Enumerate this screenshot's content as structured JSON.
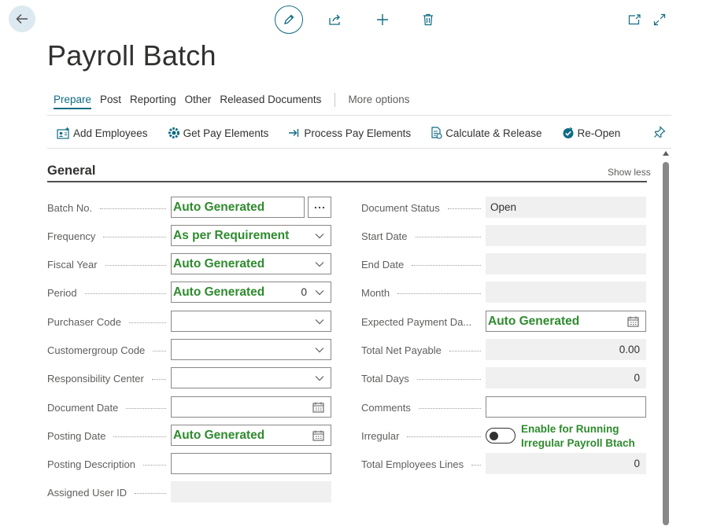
{
  "header": {
    "icons": {
      "back": "arrow-left-icon",
      "edit": "pencil-icon",
      "share": "share-icon",
      "new": "plus-icon",
      "delete": "trash-icon",
      "open_new_window": "open-in-new-window-icon",
      "expand": "expand-icon"
    }
  },
  "page": {
    "title": "Payroll Batch"
  },
  "tabs": [
    {
      "label": "Prepare",
      "active": true
    },
    {
      "label": "Post"
    },
    {
      "label": "Reporting"
    },
    {
      "label": "Other"
    },
    {
      "label": "Released Documents"
    }
  ],
  "more_options": "More options",
  "actions": [
    {
      "label": "Add Employees",
      "icon": "add-employees-icon"
    },
    {
      "label": "Get Pay Elements",
      "icon": "gear-icon"
    },
    {
      "label": "Process Pay Elements",
      "icon": "process-arrow-icon"
    },
    {
      "label": "Calculate & Release",
      "icon": "calculate-icon"
    },
    {
      "label": "Re-Open",
      "icon": "reopen-check-icon"
    }
  ],
  "section": {
    "title": "General",
    "toggle_label": "Show less"
  },
  "left_fields": {
    "batch_no": {
      "label": "Batch No.",
      "value": "Auto Generated"
    },
    "frequency": {
      "label": "Frequency",
      "value": "As per Requirement"
    },
    "fiscal_year": {
      "label": "Fiscal Year",
      "value": "Auto Generated"
    },
    "period": {
      "label": "Period",
      "value": "Auto Generated",
      "number": "0"
    },
    "purchaser_code": {
      "label": "Purchaser Code",
      "value": ""
    },
    "customergroup_code": {
      "label": "Customergroup Code",
      "value": ""
    },
    "responsibility_center": {
      "label": "Responsibility Center",
      "value": ""
    },
    "document_date": {
      "label": "Document Date",
      "value": ""
    },
    "posting_date": {
      "label": "Posting Date",
      "value": "Auto Generated"
    },
    "posting_description": {
      "label": "Posting Description",
      "value": ""
    },
    "assigned_user_id": {
      "label": "Assigned User ID",
      "value": ""
    }
  },
  "right_fields": {
    "document_status": {
      "label": "Document Status",
      "value": "Open"
    },
    "start_date": {
      "label": "Start Date",
      "value": ""
    },
    "end_date": {
      "label": "End Date",
      "value": ""
    },
    "month": {
      "label": "Month",
      "value": ""
    },
    "expected_payment_date": {
      "label": "Expected Payment Da...",
      "value": "Auto Generated"
    },
    "total_net_payable": {
      "label": "Total Net Payable",
      "value": "0.00"
    },
    "total_days": {
      "label": "Total Days",
      "value": "0"
    },
    "comments": {
      "label": "Comments",
      "value": ""
    },
    "irregular": {
      "label": "Irregular",
      "enabled": false,
      "note": "Enable for Running Irregular Payroll Btach"
    },
    "total_employees_lines": {
      "label": "Total Employees Lines",
      "value": "0"
    }
  },
  "colors": {
    "accent": "#0f6c84",
    "annotation_green": "#2e8b2e",
    "readonly_bg": "#f0f0f0"
  }
}
